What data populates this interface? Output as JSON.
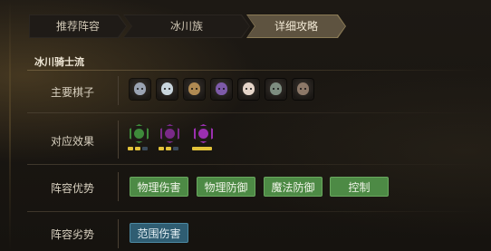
{
  "tabs": [
    {
      "label": "推荐阵容"
    },
    {
      "label": "冰川族"
    },
    {
      "label": "详细攻略"
    }
  ],
  "section": {
    "title": "冰川骑士流"
  },
  "rows": {
    "pieces": {
      "label": "主要棋子"
    },
    "effects": {
      "label": "对应效果"
    },
    "strengths": {
      "label": "阵容优势"
    },
    "weaknesses": {
      "label": "阵容劣势"
    }
  },
  "pieces": [
    {
      "icon": "white-yeti-icon",
      "color": "#9aa3b3"
    },
    {
      "icon": "horned-beast-icon",
      "color": "#c9d6de"
    },
    {
      "icon": "bearded-dwarf-icon",
      "color": "#b08a52"
    },
    {
      "icon": "purple-dragon-icon",
      "color": "#7d5aa8"
    },
    {
      "icon": "pale-woman-icon",
      "color": "#e4d4c8"
    },
    {
      "icon": "stone-golem-icon",
      "color": "#7d8d80"
    },
    {
      "icon": "troll-warrior-icon",
      "color": "#8c7868"
    }
  ],
  "effects": [
    {
      "icon": "glacier-trait-icon",
      "color": "#3e8a3a",
      "pips_active": 2,
      "pips_total": 3
    },
    {
      "icon": "knight-trait-icon",
      "color": "#7a2a88",
      "pips_active": 2,
      "pips_total": 3
    },
    {
      "icon": "demon-trait-icon",
      "color": "#9b2fb0",
      "pips_active": 1,
      "pips_total": 1
    }
  ],
  "strengths": [
    "物理伤害",
    "物理防御",
    "魔法防御",
    "控制"
  ],
  "weaknesses": [
    "范围伤害"
  ],
  "colors": {
    "pip_active": "#e2c23a",
    "pip_inactive": "#3a4a5a",
    "tag_green": "#4d8a45",
    "tag_blue": "#2f5d72"
  }
}
